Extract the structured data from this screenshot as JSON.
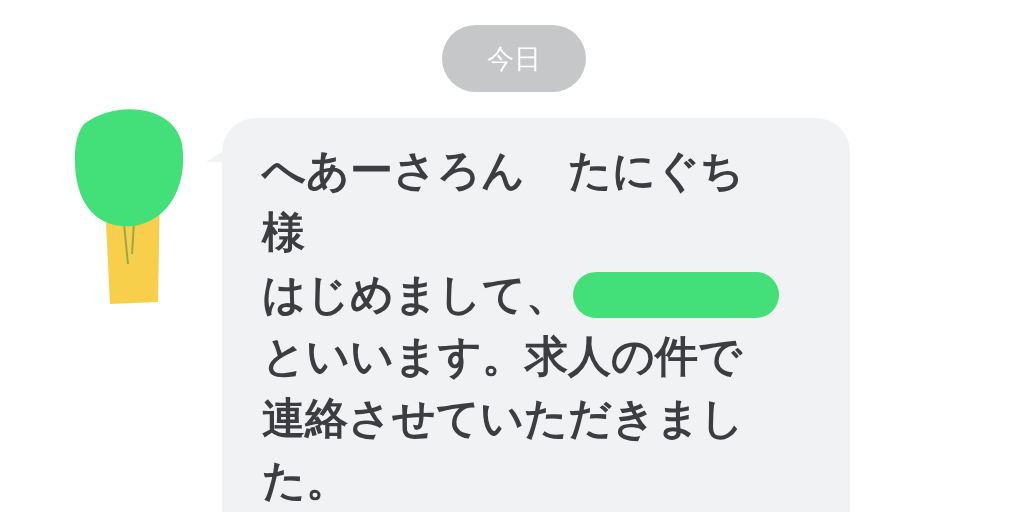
{
  "date_label": "今日",
  "message": {
    "lines": [
      {
        "text": "へあーさろん　たにぐち",
        "redacted": false
      },
      {
        "text": "様",
        "redacted": false
      },
      {
        "text": "はじめまして、",
        "redacted": true
      },
      {
        "text": "といいます。求人の件で",
        "redacted": false
      },
      {
        "text": "連絡させていただきまし",
        "redacted": false
      },
      {
        "text": "た。",
        "redacted": false
      }
    ]
  }
}
